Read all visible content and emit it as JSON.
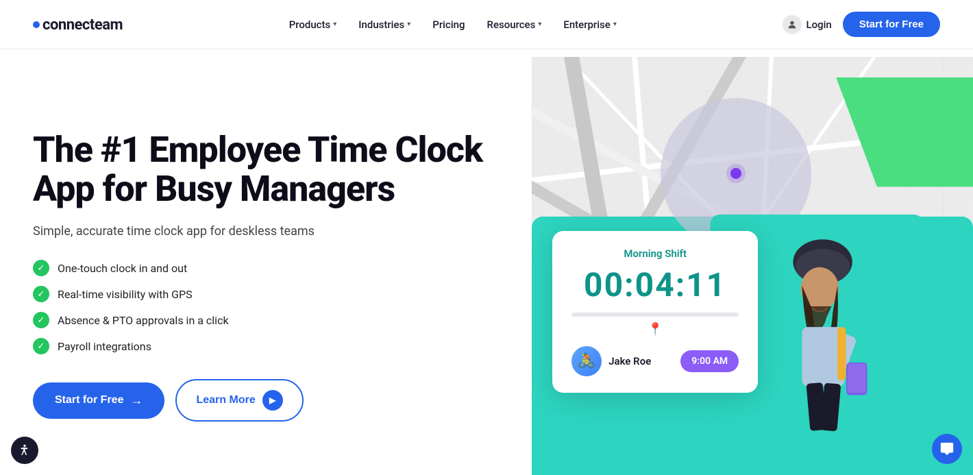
{
  "brand": {
    "name": "connecteam",
    "logo_dot": "●"
  },
  "nav": {
    "links": [
      {
        "label": "Products",
        "has_dropdown": true
      },
      {
        "label": "Industries",
        "has_dropdown": true
      },
      {
        "label": "Pricing",
        "has_dropdown": false
      },
      {
        "label": "Resources",
        "has_dropdown": true
      },
      {
        "label": "Enterprise",
        "has_dropdown": true
      }
    ],
    "login_label": "Login",
    "start_label": "Start for Free"
  },
  "hero": {
    "title": "The #1 Employee Time Clock App for Busy Managers",
    "subtitle": "Simple, accurate time clock app for deskless teams",
    "features": [
      "One-touch clock in and out",
      "Real-time visibility with GPS",
      "Absence & PTO approvals in a click",
      "Payroll integrations"
    ],
    "cta_primary": "Start for Free",
    "cta_secondary": "Learn More"
  },
  "clock_card": {
    "shift_label": "Morning Shift",
    "time": "00:04:11",
    "user_name": "Jake Roe",
    "user_time": "9:00 AM"
  },
  "colors": {
    "primary": "#2563eb",
    "teal": "#2dd4bf",
    "green": "#4ade80",
    "purple": "#8b5cf6",
    "check_green": "#22c55e"
  }
}
